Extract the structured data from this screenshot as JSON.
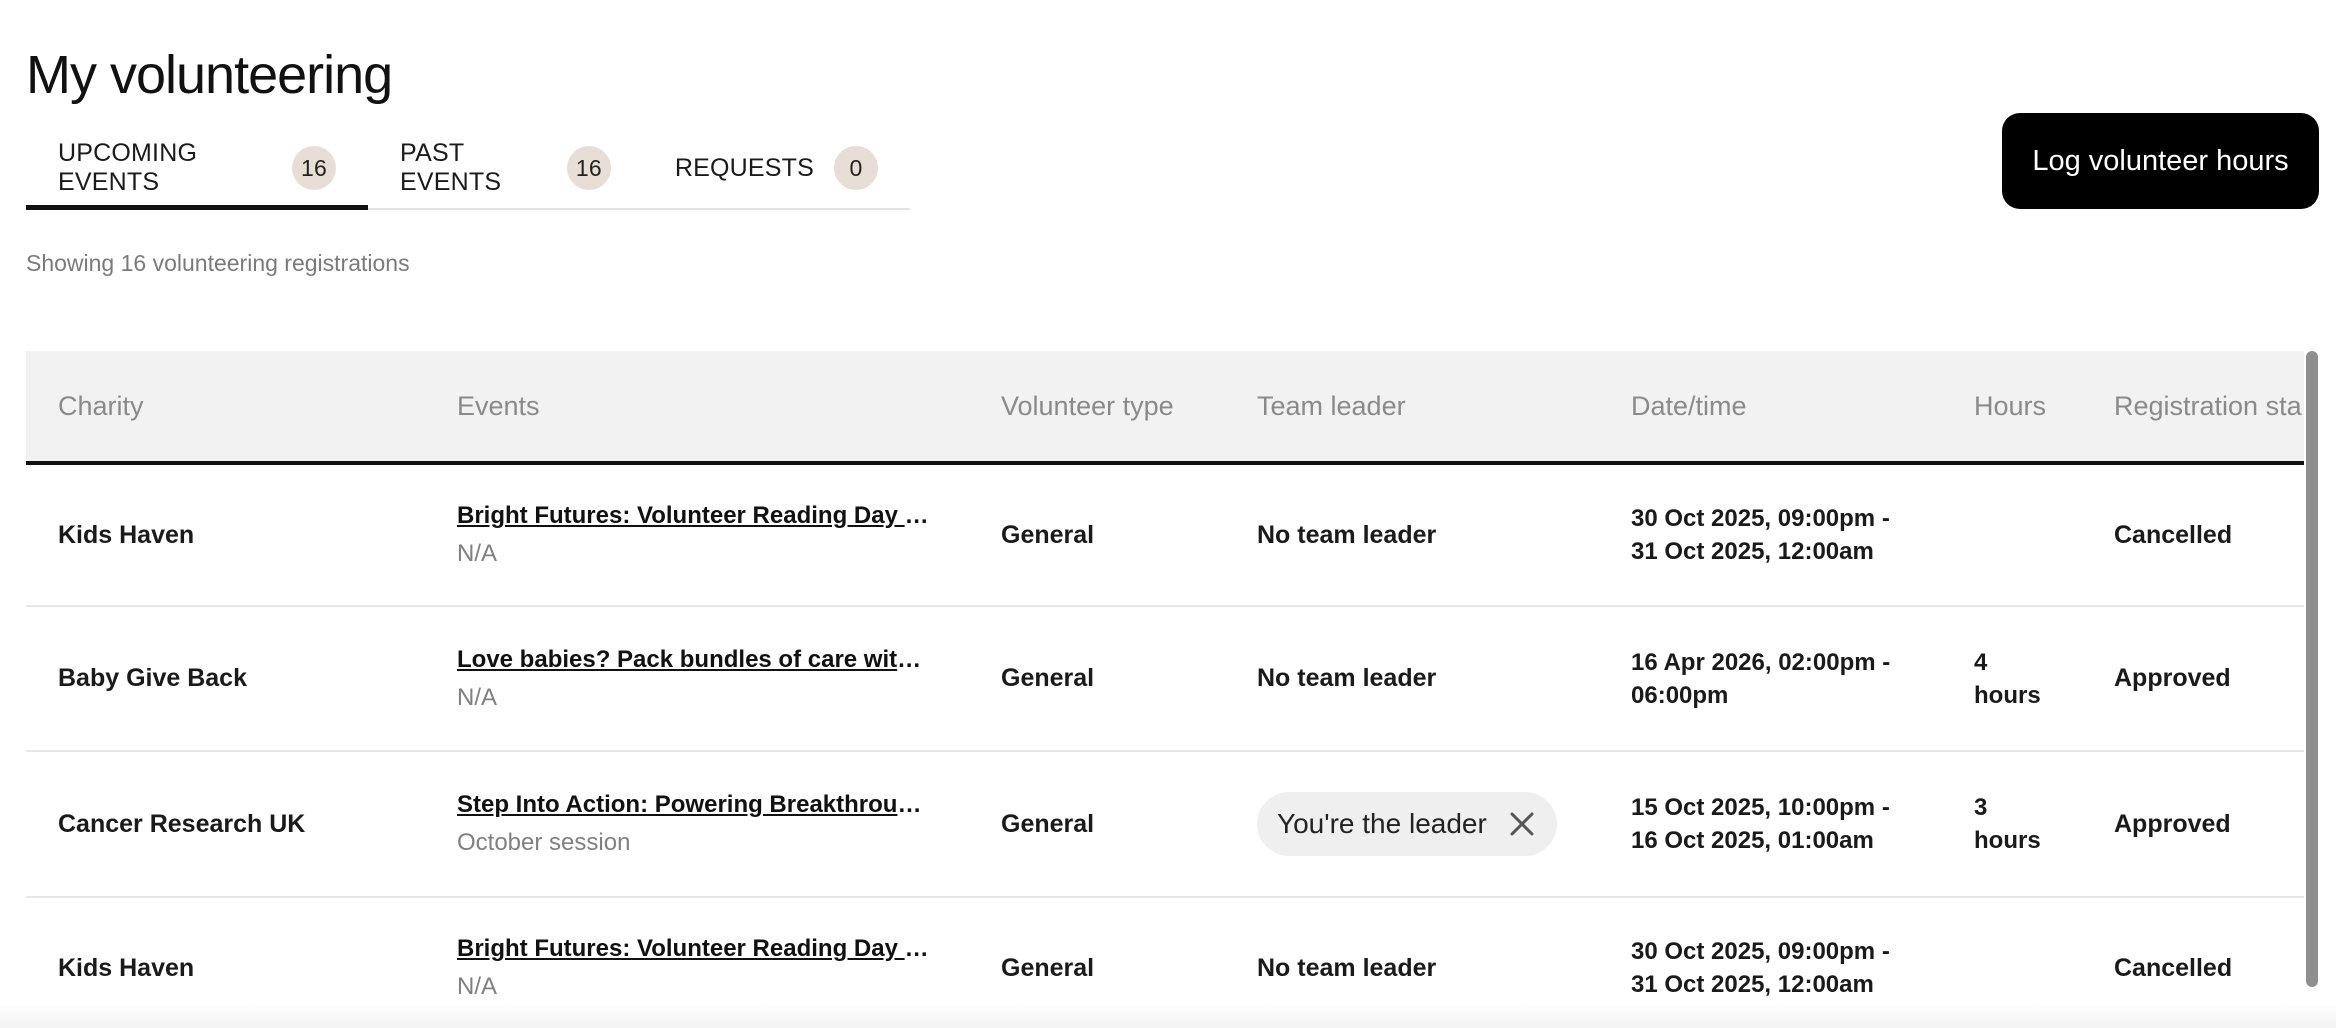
{
  "page": {
    "title": "My volunteering",
    "showing_text": "Showing 16 volunteering registrations",
    "log_button_label": "Log volunteer hours"
  },
  "tabs": [
    {
      "label": "UPCOMING EVENTS",
      "count": "16",
      "active": true
    },
    {
      "label": "PAST EVENTS",
      "count": "16",
      "active": false
    },
    {
      "label": "REQUESTS",
      "count": "0",
      "active": false
    }
  ],
  "table": {
    "headers": [
      "Charity",
      "Events",
      "Volunteer type",
      "Team leader",
      "Date/time",
      "Hours",
      "Registration sta"
    ],
    "rows": [
      {
        "charity": "Kids Haven",
        "event_title": "Bright Futures: Volunteer Reading Day at …",
        "event_sub": "N/A",
        "volunteer_type": "General",
        "team_leader": "No team leader",
        "is_leader": false,
        "date_line1": "30 Oct 2025, 09:00pm -",
        "date_line2": "31 Oct 2025, 12:00am",
        "hours_line1": "",
        "hours_line2": "",
        "status": "Cancelled"
      },
      {
        "charity": "Baby Give Back",
        "event_title": "Love babies? Pack bundles of care with B…",
        "event_sub": "N/A",
        "volunteer_type": "General",
        "team_leader": "No team leader",
        "is_leader": false,
        "date_line1": "16 Apr 2026, 02:00pm -",
        "date_line2": "06:00pm",
        "hours_line1": "4",
        "hours_line2": "hours",
        "status": "Approved"
      },
      {
        "charity": "Cancer Research UK",
        "event_title": "Step Into Action: Powering Breakthroughs …",
        "event_sub": "October session",
        "volunteer_type": "General",
        "team_leader": "You're the leader",
        "is_leader": true,
        "date_line1": "15 Oct 2025, 10:00pm -",
        "date_line2": "16 Oct 2025, 01:00am",
        "hours_line1": "3",
        "hours_line2": "hours",
        "status": "Approved"
      },
      {
        "charity": "Kids Haven",
        "event_title": "Bright Futures: Volunteer Reading Day at …",
        "event_sub": "N/A",
        "volunteer_type": "General",
        "team_leader": "No team leader",
        "is_leader": false,
        "date_line1": "30 Oct 2025, 09:00pm -",
        "date_line2": "31 Oct 2025, 12:00am",
        "hours_line1": "",
        "hours_line2": "",
        "status": "Cancelled"
      }
    ]
  },
  "icons": {
    "chip_close": "close-icon"
  }
}
